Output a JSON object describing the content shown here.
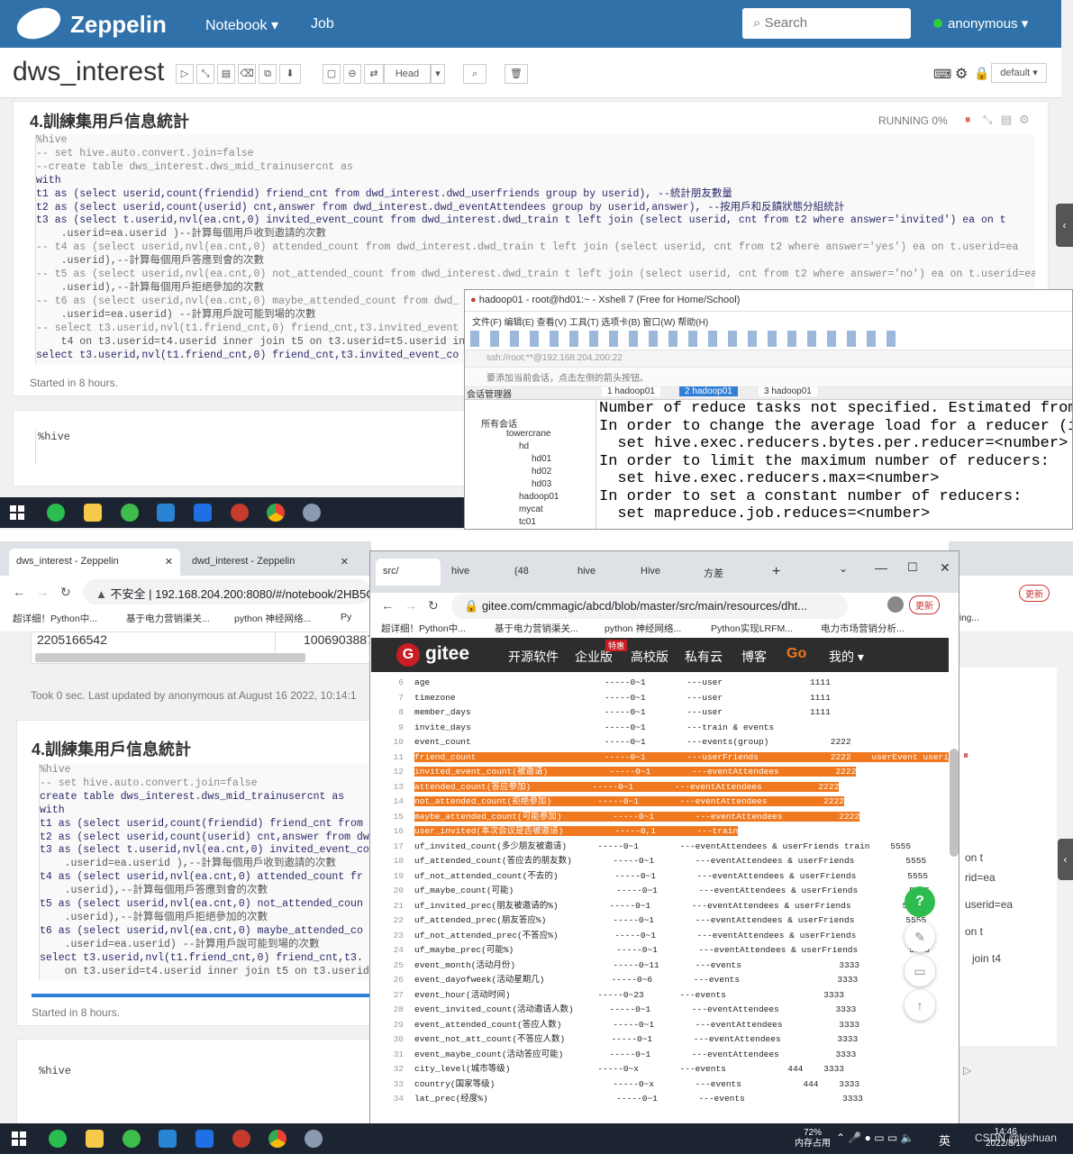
{
  "top": {
    "brand": "Zeppelin",
    "nav": [
      "Notebook ▾",
      "Job"
    ],
    "search": "Search",
    "user": "anonymous ▾",
    "notebook_title": "dws_interest",
    "head_label": "Head",
    "default_label": "default ▾",
    "para_title": "4.訓練集用戶信息統計",
    "status": "RUNNING  0%",
    "code": [
      "%hive",
      "-- set hive.auto.convert.join=false",
      "--create table dws_interest.dws_mid_trainusercnt as",
      "with",
      "t1 as (select userid,count(friendid) friend_cnt from dwd_interest.dwd_userfriends group by userid), --統計朋友數量",
      "t2 as (select userid,count(userid) cnt,answer from dwd_interest.dwd_eventAttendees group by userid,answer), --按用戶和反饋狀態分組統計",
      "t3 as (select t.userid,nvl(ea.cnt,0) invited_event_count from dwd_interest.dwd_train t left join (select userid, cnt from t2 where answer='invited') ea on t",
      "    .userid=ea.userid )--計算每個用戶收到邀請的次數",
      "-- t4 as (select userid,nvl(ea.cnt,0) attended_count from dwd_interest.dwd_train t left join (select userid, cnt from t2 where answer='yes') ea on t.userid=ea",
      "    .userid),--計算每個用戶答應到會的次數",
      "-- t5 as (select userid,nvl(ea.cnt,0) not_attended_count from dwd_interest.dwd_train t left join (select userid, cnt from t2 where answer='no') ea on t.userid=ea",
      "    .userid),--計算每個用戶拒絕參加的次數",
      "-- t6 as (select userid,nvl(ea.cnt,0) maybe_attended_count from dwd_",
      "    .userid=ea.userid) --計算用戶說可能到場的次數",
      "-- select t3.userid,nvl(t1.friend_cnt,0) friend_cnt,t3.invited_event",
      "    t4 on t3.userid=t4.userid inner join t5 on t3.userid=t5.userid inn",
      "select t3.userid,nvl(t1.friend_cnt,0) friend_cnt,t3.invited_event_co"
    ],
    "started": "Started in 8 hours.",
    "hive2": "%hive"
  },
  "xshell": {
    "title": "hadoop01 - root@hd01:~ - Xshell 7 (Free for Home/School)",
    "menu": "文件(F)  编辑(E)  查看(V)  工具(T)  选项卡(B)  窗口(W)  帮助(H)",
    "address": "ssh://root:**@192.168.204.200:22",
    "hint": "要添加当前会话，点击左侧的箭头按钮。",
    "session_label": "会话管理器",
    "tabs": [
      "1 hadoop01",
      "2 hadoop01",
      "3 hadoop01"
    ],
    "tree": [
      "所有会话",
      "towercrane",
      "hd",
      "hd01",
      "hd02",
      "hd03",
      "hadoop01",
      "mycat",
      "tc01"
    ],
    "terminal": [
      "Number of reduce tasks not specified. Estimated from",
      "In order to change the average load for a reducer (in",
      "  set hive.exec.reducers.bytes.per.reducer=<number>",
      "In order to limit the maximum number of reducers:",
      "  set hive.exec.reducers.max=<number>",
      "In order to set a constant number of reducers:",
      "  set mapreduce.job.reduces=<number>"
    ]
  },
  "bottom": {
    "tabs_left": [
      "dws_interest - Zeppelin",
      "dwd_interest - Zeppelin"
    ],
    "url_left_prefix": "不安全",
    "url_left": "192.168.204.200:8080/#/notebook/2HB5CJ",
    "bookmarks_left": [
      "超详细！Python中...",
      "基于电力营销渠关...",
      "python 神经网络...",
      "Py"
    ],
    "table_row": [
      "2205166542",
      "1006903887"
    ],
    "took": "Took 0 sec. Last updated by anonymous at August 16 2022, 10:14:1",
    "para_title": "4.訓練集用戶信息統計",
    "code": [
      "%hive",
      "-- set hive.auto.convert.join=false",
      "create table dws_interest.dws_mid_trainusercnt as",
      "with",
      "t1 as (select userid,count(friendid) friend_cnt from d",
      "t2 as (select userid,count(userid) cnt,answer from dwd",
      "t3 as (select t.userid,nvl(ea.cnt,0) invited_event_cou",
      "    .userid=ea.userid ),--計算每個用戶收到邀請的次數",
      "t4 as (select userid,nvl(ea.cnt,0) attended_count fr",
      "    .userid),--計算每個用戶答應到會的次數",
      "t5 as (select userid,nvl(ea.cnt,0) not_attended_coun",
      "    .userid),--計算每個用戶拒絕參加的次數",
      "t6 as (select userid,nvl(ea.cnt,0) maybe_attended_co",
      "    .userid=ea.userid) --計算用戶說可能到場的次數",
      "select t3.userid,nvl(t1.friend_cnt,0) friend_cnt,t3.",
      "    on t3.userid=t4.userid inner join t5 on t3.userid="
    ],
    "started": "Started in 8 hours.",
    "hive2": "%hive",
    "right_frag": [
      "on t",
      "rid=ea",
      "userid=ea",
      "on t",
      "join t4"
    ],
    "tabs_mid": [
      "src/",
      "hive",
      "(48",
      "hive",
      "Hive",
      "方差"
    ],
    "url_mid": "gitee.com/cmmagic/abcd/blob/master/src/main/resources/dht...",
    "update_label": "更新",
    "bookmarks_mid": [
      "超详细！Python中...",
      "基于电力营销渠关...",
      "python 神经网络...",
      "Python实现LRFM...",
      "电力市场营销分析..."
    ],
    "gitee_logo": "gitee",
    "gitee_nav": [
      "开源软件",
      "企业版",
      "高校版",
      "私有云",
      "博客",
      "Go",
      "我的 ▾"
    ],
    "gitee_badge": "特惠",
    "gitee_lines": [
      {
        "n": "6",
        "t": "age                                  -----0~1        ---user                 1111",
        "h": false
      },
      {
        "n": "7",
        "t": "timezone                             -----0~1        ---user                 1111",
        "h": false
      },
      {
        "n": "8",
        "t": "member_days                          -----0~1        ---user                 1111",
        "h": false
      },
      {
        "n": "9",
        "t": "invite_days                          -----0~1        ---train & events",
        "h": false
      },
      {
        "n": "10",
        "t": "event_count                          -----0~1        ---events(group)            2222",
        "h": false
      },
      {
        "n": "11",
        "t": "friend_count                         -----0~1        ---userFriends              2222    userEvent userid",
        "h": true
      },
      {
        "n": "12",
        "t": "invited_event_count(被邀请)            -----0~1        ---eventAttendees           2222",
        "h": true
      },
      {
        "n": "13",
        "t": "attended_count(答应参加)            -----0~1        ---eventAttendees           2222",
        "h": true
      },
      {
        "n": "14",
        "t": "not_attended_count(拒绝参加)         -----0~1        ---eventAttendees           2222",
        "h": true
      },
      {
        "n": "15",
        "t": "maybe_attended_count(可能参加)          -----0~1        ---eventAttendees           2222",
        "h": true
      },
      {
        "n": "16",
        "t": "user_invited(本次会议是否被邀请)          -----0,1        ---train",
        "h": true
      },
      {
        "n": "17",
        "t": "uf_invited_count(多少朋友被邀请)      -----0~1        ---eventAttendees & userFriends train    5555",
        "h": false
      },
      {
        "n": "18",
        "t": "uf_attended_count(答应去的朋友数)        -----0~1        ---eventAttendees & userFriends          5555",
        "h": false
      },
      {
        "n": "19",
        "t": "uf_not_attended_count(不去的)           -----0~1        ---eventAttendees & userFriends          5555",
        "h": false
      },
      {
        "n": "20",
        "t": "uf_maybe_count(可能)                    -----0~1        ---eventAttendees & userFriends          5555",
        "h": false
      },
      {
        "n": "21",
        "t": "uf_invited_prec(朋友被邀请的%)          -----0~1        ---eventAttendees & userFriends          5555",
        "h": false
      },
      {
        "n": "22",
        "t": "uf_attended_prec(朋友答应%)             -----0~1        ---eventAttendees & userFriends          5555",
        "h": false
      },
      {
        "n": "23",
        "t": "uf_not_attended_prec(不答应%)           -----0~1        ---eventAttendees & userFriends          5555",
        "h": false
      },
      {
        "n": "24",
        "t": "uf_maybe_prec(可能%)                    -----0~1        ---eventAttendees & userFriends          5555",
        "h": false
      },
      {
        "n": "25",
        "t": "event_month(活动月份)                   -----0~11       ---events                   3333",
        "h": false
      },
      {
        "n": "26",
        "t": "event_dayofweek(活动星期几)             -----0~6        ---events                   3333",
        "h": false
      },
      {
        "n": "27",
        "t": "event_hour(活动时间)                 -----0~23       ---events                   3333",
        "h": false
      },
      {
        "n": "28",
        "t": "event_invited_count(活动邀请人数)       -----0~1        ---eventAttendees           3333",
        "h": false
      },
      {
        "n": "29",
        "t": "event_attended_count(答应人数)          -----0~1        ---eventAttendees           3333",
        "h": false
      },
      {
        "n": "30",
        "t": "event_not_att_count(不答应人数)         -----0~1        ---eventAttendees           3333",
        "h": false
      },
      {
        "n": "31",
        "t": "event_maybe_count(活动答应可能)         -----0~1        ---eventAttendees           3333",
        "h": false
      },
      {
        "n": "32",
        "t": "city_level(城市等级)                 -----0~x        ---events            444    3333",
        "h": false
      },
      {
        "n": "33",
        "t": "country(国家等级)                       -----0~x        ---events            444    3333",
        "h": false
      },
      {
        "n": "34",
        "t": "lat_prec(经度%)                         -----0~1        ---events                   3333",
        "h": false
      }
    ],
    "right_url": "ing...",
    "tray": {
      "mem_pct": "72%",
      "mem_label": "内存占用",
      "lang": "英",
      "time": "14:46",
      "date": "2022/8/16",
      "watermark": "CSDN @kjshuan"
    }
  }
}
